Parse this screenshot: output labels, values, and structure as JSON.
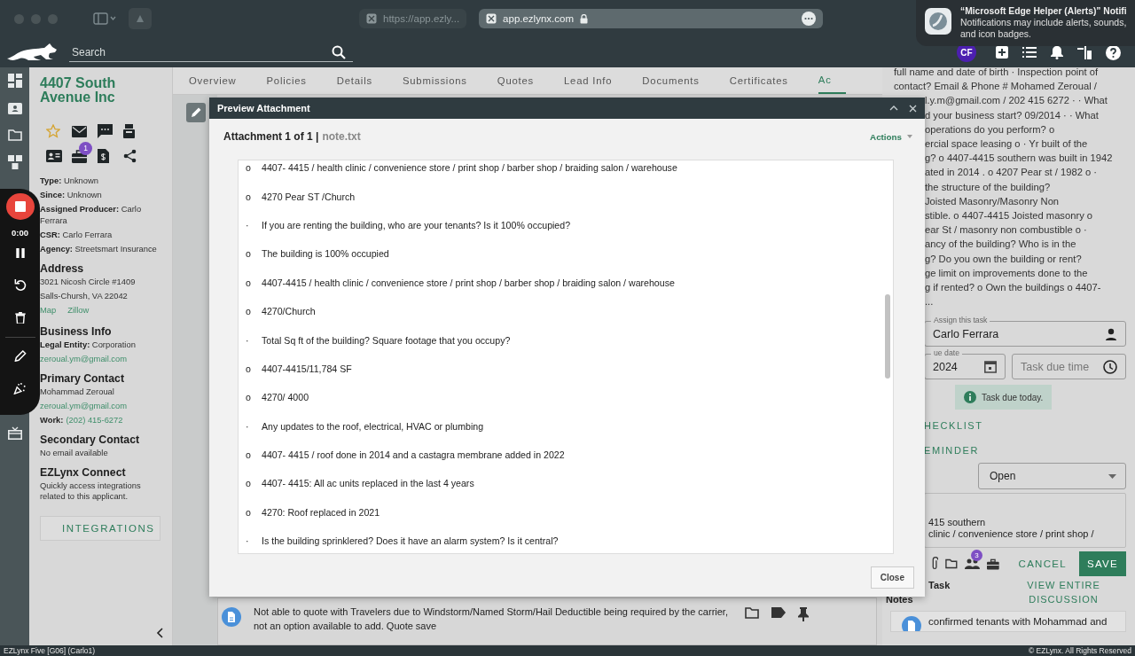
{
  "browser": {
    "tabs": [
      {
        "label": "https://app.ezly...",
        "selected": false
      },
      {
        "label": "app.ezlynx.com",
        "selected": true
      }
    ]
  },
  "notification": {
    "title": "“Microsoft Edge Helper (Alerts)” Notifi",
    "lines": [
      "Notifications may include alerts, sounds,",
      "and icon badges."
    ]
  },
  "header": {
    "search_placeholder": "Search",
    "avatar": "CF"
  },
  "nav_tabs": [
    {
      "label": "Overview",
      "selected": false
    },
    {
      "label": "Policies",
      "selected": false
    },
    {
      "label": "Details",
      "selected": false
    },
    {
      "label": "Submissions",
      "selected": false
    },
    {
      "label": "Quotes",
      "selected": false
    },
    {
      "label": "Lead Info",
      "selected": false
    },
    {
      "label": "Documents",
      "selected": false
    },
    {
      "label": "Certificates",
      "selected": false
    },
    {
      "label": "Ac",
      "selected": true
    }
  ],
  "account": {
    "name": "4407 South Avenue Inc",
    "briefcase_badge": "1",
    "fields": [
      {
        "label": "Type:",
        "value": "Unknown"
      },
      {
        "label": "Since:",
        "value": "Unknown"
      },
      {
        "label": "Assigned Producer:",
        "value": "Carlo Ferrara"
      },
      {
        "label": "CSR:",
        "value": "Carlo Ferrara"
      },
      {
        "label": "Agency:",
        "value": "Streetsmart Insurance"
      }
    ],
    "address": {
      "heading": "Address",
      "lines": [
        "3021 Nicosh Circle #1409",
        "Salls-Chursh, VA 22042"
      ],
      "links": [
        "Map",
        "Zillow"
      ]
    },
    "business": {
      "heading": "Business Info",
      "label": "Legal Entity:",
      "value": "Corporation",
      "email": "zeroual.ym@gmail.com"
    },
    "primary": {
      "heading": "Primary Contact",
      "name": "Mohammad Zeroual",
      "email": "zeroual.ym@gmail.com",
      "work_label": "Work:",
      "work": "(202) 415-6272"
    },
    "secondary": {
      "heading": "Secondary Contact",
      "text": "No email available"
    },
    "connect": {
      "heading": "EZLynx Connect",
      "text": "Quickly access integrations related to this applicant.",
      "button": "INTEGRATIONS"
    }
  },
  "recorder": {
    "time": "0:00"
  },
  "modal": {
    "title": "Preview Attachment",
    "attachment": "Attachment 1 of 1 |",
    "file": "note.txt",
    "actions": "Actions",
    "lines": [
      {
        "marker": "o",
        "text": "4407- 4415 / health clinic / convenience store / print shop / barber shop / braiding salon / warehouse"
      },
      {
        "marker": "o",
        "text": "4270 Pear ST /Church"
      },
      {
        "marker": "·",
        "text": "If you are renting the building, who are your tenants? Is it 100% occupied?"
      },
      {
        "marker": "o",
        "text": "The building is 100% occupied"
      },
      {
        "marker": "o",
        "text": "4407-4415 / health clinic / convenience store / print shop / barber shop / braiding salon / warehouse"
      },
      {
        "marker": "o",
        "text": "4270/Church"
      },
      {
        "marker": "·",
        "text": "Total Sq ft of the building? Square footage that you occupy?"
      },
      {
        "marker": "o",
        "text": "4407-4415/11,784 SF"
      },
      {
        "marker": "o",
        "text": "4270/ 4000"
      },
      {
        "marker": "·",
        "text": "Any updates to the roof, electrical, HVAC or plumbing"
      },
      {
        "marker": "o",
        "text": "4407- 4415 / roof done in 2014 and a castagra membrane added in 2022"
      },
      {
        "marker": "o",
        "text": "4407- 4415: All ac units replaced in the last 4 years"
      },
      {
        "marker": "o",
        "text": "4270: Roof replaced in 2021"
      },
      {
        "marker": "·",
        "text": "Is the building sprinklered? Does it have an alarm system? Is it central?"
      }
    ],
    "close": "Close"
  },
  "note": {
    "text": "Not able to quote with Travelers due to Windstorm/Named Storm/Hail Deductible being required by the carrier, not an option available to add. Quote save"
  },
  "task": {
    "text_top": [
      "full name and date of birth · Inspection point of",
      "contact? Email & Phone # Mohamed Zeroual /"
    ],
    "text_rest": [
      "l.y.m@gmail.com / 202 415 6272 · · What",
      "d your business start? 09/2014 · · What",
      "operations do you perform? o",
      "ercial space leasing o · Yr built of the",
      "g? o 4407-4415 southern was built in 1942",
      "ated in 2014 . o 4207 Pear st / 1982 o ·",
      "the structure of the building?",
      "Joisted Masonry/Masonry Non",
      "stible. o 4407-4415 Joisted masonry o",
      "ear St / masonry non combustible o ·",
      "ancy of the building? Who is in the",
      "g? Do you own the building or rent?",
      "ge limit on improvements done to the",
      "g if rented? o Own the buildings o 4407-",
      "..."
    ],
    "assign_label": "Assign this task",
    "assignee": "Carlo Ferrara",
    "due_label": "ue date",
    "due_value": "2024",
    "time_placeholder": "Task due time",
    "due_chip": "Task due today.",
    "checklist": "HECKLIST",
    "reminder": "EMINDER",
    "status": "Open",
    "textarea_lines": [
      "415 southern",
      "clinic / convenience store / print shop /"
    ],
    "people_badge": "3",
    "cancel": "CANCEL",
    "save": "SAVE",
    "notes_heading": [
      "Task",
      "Notes"
    ],
    "view_link": "VIEW ENTIRE DISCUSSION",
    "note_preview": "confirmed tenants with Mohammad and"
  },
  "footer": {
    "left": "EZLynx Five [G06] (Carlo1)",
    "right": "© EZLynx. All Rights Reserved"
  }
}
